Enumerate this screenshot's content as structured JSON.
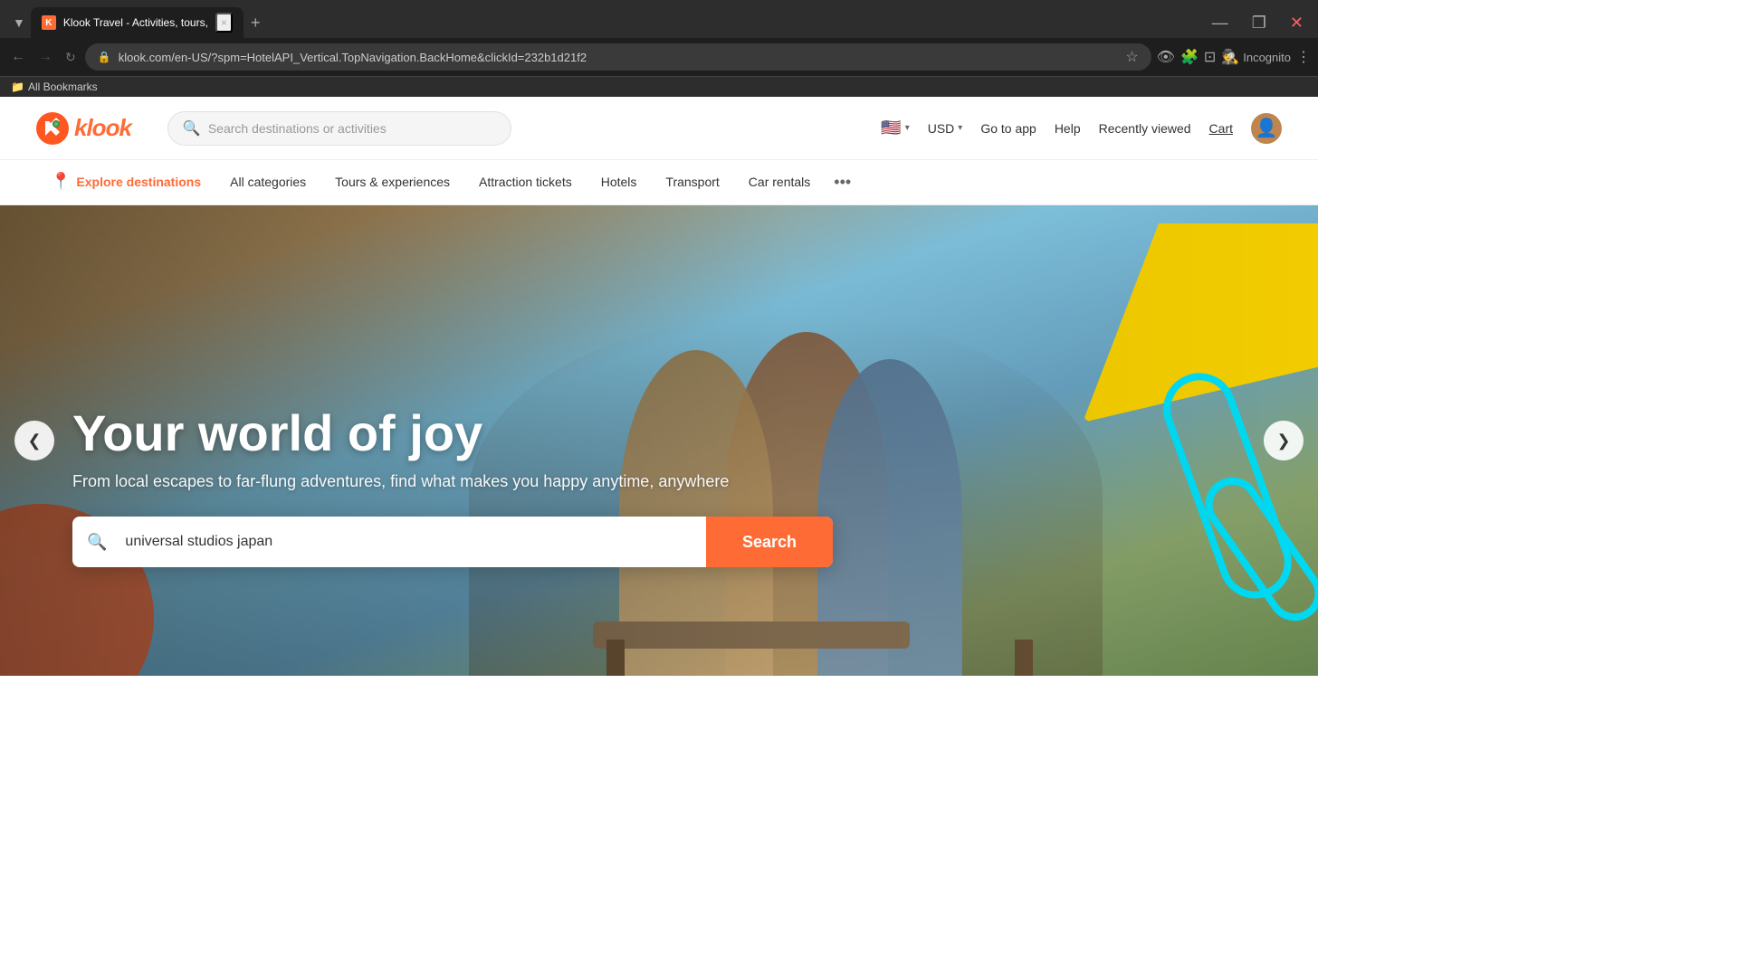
{
  "browser": {
    "tab": {
      "favicon_bg": "#ff6b35",
      "favicon_text": "K",
      "title": "Klook Travel - Activities, tours,",
      "close_symbol": "×"
    },
    "new_tab_symbol": "+",
    "address": "klook.com/en-US/?spm=HotelAPI_Vertical.TopNavigation.BackHome&clickId=232b1d21f2",
    "back_symbol": "←",
    "forward_symbol": "→",
    "reload_symbol": "↻",
    "incognito_label": "Incognito",
    "bookmarks_label": "All Bookmarks",
    "controls": {
      "minimize": "—",
      "maximize": "❐",
      "close": "✕"
    }
  },
  "header": {
    "logo_text": "klook",
    "search_placeholder": "Search destinations or activities",
    "flag_emoji": "🇺🇸",
    "currency": "USD",
    "currency_chevron": "▾",
    "flag_chevron": "▾",
    "go_to_app": "Go to app",
    "help": "Help",
    "recently_viewed": "Recently viewed",
    "cart": "Cart"
  },
  "nav": {
    "items": [
      {
        "label": "Explore destinations",
        "icon": "location-dot",
        "active": true
      },
      {
        "label": "All categories",
        "active": false
      },
      {
        "label": "Tours & experiences",
        "active": false
      },
      {
        "label": "Attraction tickets",
        "active": false
      },
      {
        "label": "Hotels",
        "active": false
      },
      {
        "label": "Transport",
        "active": false
      },
      {
        "label": "Car rentals",
        "active": false
      }
    ],
    "more_symbol": "•••"
  },
  "hero": {
    "title": "Your world of joy",
    "subtitle": "From local escapes to far-flung adventures, find what makes you happy anytime, anywhere",
    "search_value": "universal studios japan",
    "search_placeholder": "Search destinations or activities",
    "search_button": "Search",
    "prev_symbol": "❮",
    "next_symbol": "❯"
  }
}
